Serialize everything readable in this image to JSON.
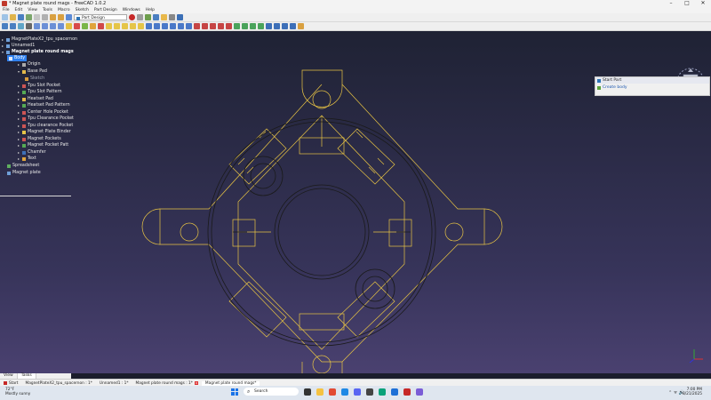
{
  "window": {
    "title": "* Magnet plate round mags - FreeCAD 1.0.2"
  },
  "menu": [
    "File",
    "Edit",
    "View",
    "Tools",
    "Macro",
    "Sketch",
    "Part Design",
    "Windows",
    "Help"
  ],
  "workbench": {
    "selected": "Part Design"
  },
  "tree": {
    "items": [
      {
        "label": "MagnetPlateX2_tpu_spacernon"
      },
      {
        "label": "Unnamed1"
      },
      {
        "label": "Magnet plate round mags"
      },
      {
        "label": "Body"
      },
      {
        "label": "Origin"
      },
      {
        "label": "Base Pad"
      },
      {
        "label": "Sketch"
      },
      {
        "label": "Tpu Slot Pocket"
      },
      {
        "label": "Tpu Slot Pattern"
      },
      {
        "label": "Heatset Pad"
      },
      {
        "label": "Heatset Pad Pattern"
      },
      {
        "label": "Center Hole Pocket"
      },
      {
        "label": "Tpu Clearance Pocket"
      },
      {
        "label": "Tpu clearance Pocket"
      },
      {
        "label": "Magnet Plate Binder"
      },
      {
        "label": "Magnet Pockets"
      },
      {
        "label": "Magnet Pocket Patt"
      },
      {
        "label": "Chamfer"
      },
      {
        "label": "Text"
      },
      {
        "label": "Spreadsheet"
      },
      {
        "label": "Magnet plate"
      }
    ]
  },
  "tasks": {
    "header": "Start Part",
    "action": "Create body"
  },
  "bottom_tabs": [
    "View",
    "Tasks"
  ],
  "mdi_tabs": [
    "MagnetPlateX2_tpu_spacernon : 1*",
    "Unnamed1 : 1*",
    "Magnet plate round mags : 1*",
    "Magnet plate round mags*"
  ],
  "taskbar": {
    "weather_temp": "72°F",
    "weather_desc": "Mostly sunny",
    "search_placeholder": "Search",
    "time": "7:00 PM",
    "date": "8/21/2025"
  }
}
